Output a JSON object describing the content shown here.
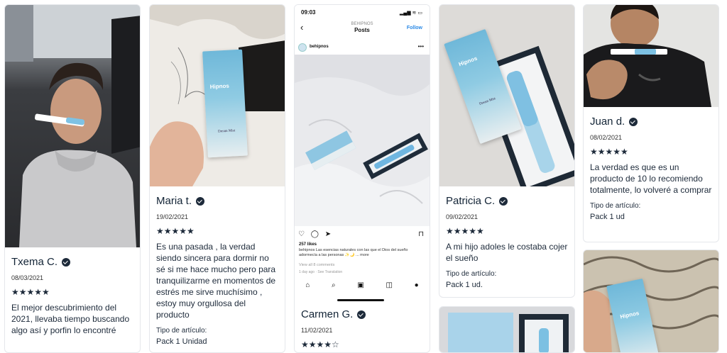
{
  "reviews": [
    {
      "name": "Txema C.",
      "date": "08/03/2021",
      "stars": "★★★★★",
      "text": "El mejor descubrimiento del 2021, llevaba tiempo buscando algo así y porfin lo encontré"
    },
    {
      "name": "Maria t.",
      "date": "19/02/2021",
      "stars": "★★★★★",
      "text": "Es una pasada , la verdad siendo sincera para dormir no sé si me hace mucho pero para tranquilizarme en momentos de estrés me sirve muchísimo , estoy muy orgullosa del producto",
      "type_label": "Tipo de artículo:",
      "type_value": "Pack 1 Unidad"
    },
    {
      "name": "Carmen G.",
      "date": "11/02/2021",
      "stars": "★★★★☆"
    },
    {
      "name": "Patricia C.",
      "date": "09/02/2021",
      "stars": "★★★★★",
      "text": "A mi hijo adoles le costaba cojer el sueño",
      "type_label": "Tipo de artículo:",
      "type_value": "Pack 1 ud."
    },
    {
      "name": "Juan d.",
      "date": "08/02/2021",
      "stars": "★★★★★",
      "text": "La verdad es que es un producto de 10 lo recomiendo totalmente, lo volveré a comprar",
      "type_label": "Tipo de artículo:",
      "type_value": "Pack 1 ud"
    }
  ],
  "product": {
    "brand": "Hipnos",
    "name": "Dream Mist"
  },
  "instagram": {
    "time": "09:03",
    "status": "▂▄▆ ≋ ▭",
    "back": "‹",
    "account": "BEHIPNOS",
    "title": "Posts",
    "follow": "Follow",
    "handle": "behipnos",
    "more": "•••",
    "actions": "♡ ◯ ➤",
    "bookmark": "⊓",
    "likes": "257 likes",
    "caption": "behipnos Las esencias naturales con las que el Dios del sueño adormecía a las personas ✨🌙 ... more",
    "comments": "View all 8 comments",
    "posted": "1 day ago · See Translation",
    "nav": [
      "⌂",
      "⌕",
      "▣",
      "◫",
      "●"
    ]
  },
  "colors": {
    "text": "#1d2a3a",
    "product_blue": "#6fb8d9",
    "ig_link": "#2b8ae6"
  }
}
